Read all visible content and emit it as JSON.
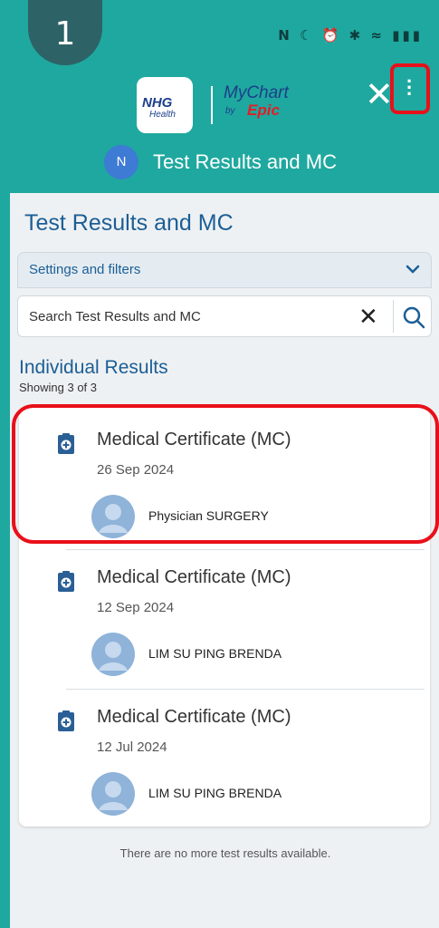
{
  "step_number": "1",
  "status_bar": {
    "icons_text": "N ☾ ⏰ ✱ ≈ ▮▮▮",
    "battery": "71"
  },
  "header": {
    "logo_primary": "NHG",
    "logo_secondary": "Health",
    "brand_top": "MyChart",
    "brand_by": "by",
    "brand_bottom": "Epic",
    "user_initial": "N",
    "title": "Test Results and MC",
    "menu_icon": "more-vertical-icon",
    "close_icon": "close-icon"
  },
  "page": {
    "title": "Test Results and MC",
    "filters_label": "Settings and filters",
    "search_placeholder": "Search Test Results and MC",
    "section_title": "Individual Results",
    "section_count": "Showing 3 of 3",
    "no_more": "There are no more test results available."
  },
  "results": [
    {
      "title": "Medical Certificate (MC)",
      "date": "26 Sep 2024",
      "provider": "Physician SURGERY"
    },
    {
      "title": "Medical Certificate (MC)",
      "date": "12 Sep 2024",
      "provider": "LIM SU PING BRENDA"
    },
    {
      "title": "Medical Certificate (MC)",
      "date": "12 Jul 2024",
      "provider": "LIM SU PING BRENDA"
    }
  ],
  "colors": {
    "teal": "#1fa89f",
    "accent_blue": "#1c5e95",
    "highlight_red": "#e8101a"
  }
}
